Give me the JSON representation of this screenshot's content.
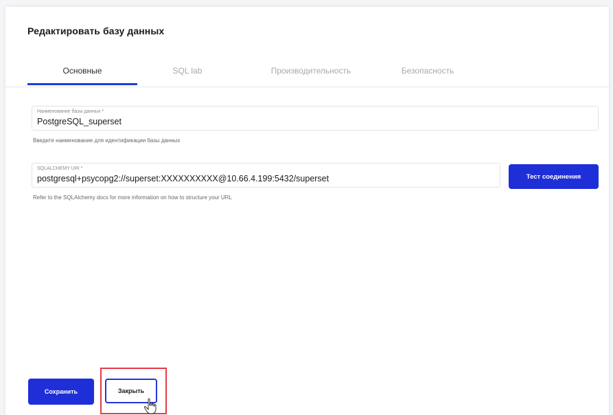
{
  "modal": {
    "title": "Редактировать базу данных"
  },
  "tabs": [
    {
      "label": "Основные",
      "active": true
    },
    {
      "label": "SQL lab",
      "active": false
    },
    {
      "label": "Производительность",
      "active": false
    },
    {
      "label": "Безопасность",
      "active": false
    }
  ],
  "fields": {
    "db_name": {
      "label": "Наименование базы данных *",
      "value": "PostgreSQL_superset",
      "helper": "Введите наименование для идентификации базы данных"
    },
    "sqlalchemy_uri": {
      "label": "SQLALCHEMY URI *",
      "value": "postgresql+psycopg2://superset:XXXXXXXXXX@10.66.4.199:5432/superset",
      "helper": "Refer to the SQLAlchemy docs for more information on how to structure your URL"
    }
  },
  "buttons": {
    "test_connection": "Тест соединения",
    "save": "Сохранить",
    "close": "Закрыть"
  },
  "colors": {
    "primary": "#1f2fd8",
    "highlight": "#e63946"
  }
}
